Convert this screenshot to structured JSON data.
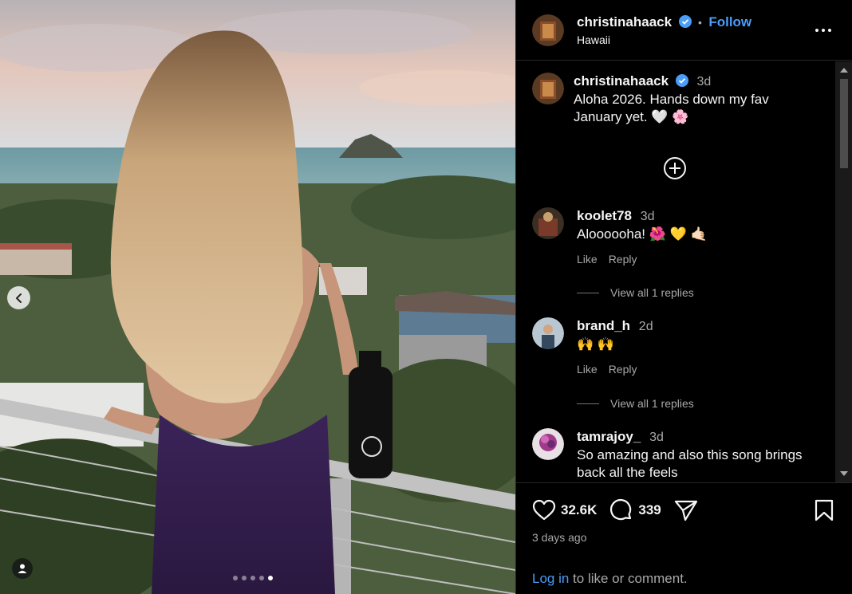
{
  "post": {
    "slide_count": 5,
    "active_slide": 5
  },
  "header": {
    "username": "christinahaack",
    "separator": "•",
    "follow_label": "Follow",
    "location": "Hawaii"
  },
  "caption": {
    "username": "christinahaack",
    "time": "3d",
    "text": "Aloha 2026. Hands down my fav January yet. 🤍 🌸"
  },
  "comments": [
    {
      "username": "koolet78",
      "time": "3d",
      "text": "Aloooooha! 🌺 💛 🤙🏻",
      "like_label": "Like",
      "reply_label": "Reply",
      "view_replies": "View all 1 replies"
    },
    {
      "username": "brand_h",
      "time": "2d",
      "text": "🙌 🙌",
      "like_label": "Like",
      "reply_label": "Reply",
      "view_replies": "View all 1 replies"
    },
    {
      "username": "tamrajoy_",
      "time": "3d",
      "text": "So amazing and also this song brings back all the feels"
    }
  ],
  "stats": {
    "likes": "32.6K",
    "comments": "339",
    "time_ago": "3 days ago"
  },
  "footer": {
    "login_link": "Log in",
    "login_rest": " to like or comment."
  },
  "colors": {
    "accent": "#4a9df8",
    "background": "#000000",
    "muted": "#a8a8a8"
  }
}
